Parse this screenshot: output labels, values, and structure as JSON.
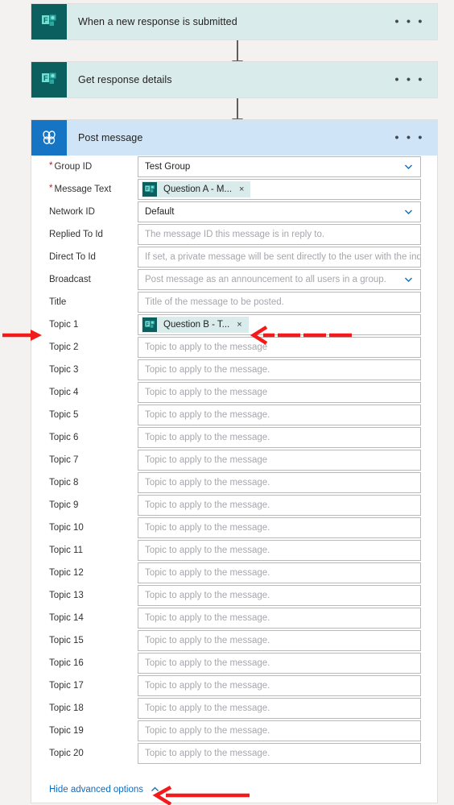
{
  "flow": {
    "steps": [
      {
        "id": "trigger",
        "title": "When a new response is submitted",
        "icon": "microsoft-forms-icon",
        "header_color": "#d9ebeb",
        "icon_bg": "#0c5f5f",
        "overflow_label": "• • •"
      },
      {
        "id": "get-response",
        "title": "Get response details",
        "icon": "microsoft-forms-icon",
        "header_color": "#d9ebeb",
        "icon_bg": "#0c5f5f",
        "overflow_label": "• • •"
      },
      {
        "id": "post-message",
        "title": "Post message",
        "icon": "yammer-icon",
        "header_color": "#cfe4f7",
        "icon_bg": "#1574c4",
        "overflow_label": "• • •"
      }
    ]
  },
  "post_message_form": {
    "fields": [
      {
        "label": "Group ID",
        "required": true,
        "type": "dropdown",
        "value": "Test Group",
        "placeholder": ""
      },
      {
        "label": "Message Text",
        "required": true,
        "type": "token",
        "token": "Question A - M...",
        "token_icon": "microsoft-forms-icon",
        "token_remove": "×",
        "placeholder": ""
      },
      {
        "label": "Network ID",
        "required": false,
        "type": "dropdown",
        "value": "Default",
        "placeholder": ""
      },
      {
        "label": "Replied To Id",
        "required": false,
        "type": "text",
        "value": "",
        "placeholder": "The message ID this message is in reply to."
      },
      {
        "label": "Direct To Id",
        "required": false,
        "type": "text",
        "value": "",
        "placeholder": "If set, a private message will be sent directly to the user with the indicated ID."
      },
      {
        "label": "Broadcast",
        "required": false,
        "type": "dropdown",
        "value": "",
        "placeholder": "Post message as an announcement to all users in a group."
      },
      {
        "label": "Title",
        "required": false,
        "type": "text",
        "value": "",
        "placeholder": "Title of the message to be posted."
      },
      {
        "label": "Topic 1",
        "required": false,
        "type": "token",
        "token": "Question B - T...",
        "token_icon": "microsoft-forms-icon",
        "token_remove": "×",
        "placeholder": ""
      },
      {
        "label": "Topic 2",
        "required": false,
        "type": "text",
        "value": "",
        "placeholder": "Topic to apply to the message"
      },
      {
        "label": "Topic 3",
        "required": false,
        "type": "text",
        "value": "",
        "placeholder": "Topic to apply to the message."
      },
      {
        "label": "Topic 4",
        "required": false,
        "type": "text",
        "value": "",
        "placeholder": "Topic to apply to the message"
      },
      {
        "label": "Topic 5",
        "required": false,
        "type": "text",
        "value": "",
        "placeholder": "Topic to apply to the message."
      },
      {
        "label": "Topic 6",
        "required": false,
        "type": "text",
        "value": "",
        "placeholder": "Topic to apply to the message."
      },
      {
        "label": "Topic 7",
        "required": false,
        "type": "text",
        "value": "",
        "placeholder": "Topic to apply to the message"
      },
      {
        "label": "Topic 8",
        "required": false,
        "type": "text",
        "value": "",
        "placeholder": "Topic to apply to the message."
      },
      {
        "label": "Topic 9",
        "required": false,
        "type": "text",
        "value": "",
        "placeholder": "Topic to apply to the message."
      },
      {
        "label": "Topic 10",
        "required": false,
        "type": "text",
        "value": "",
        "placeholder": "Topic to apply to the message."
      },
      {
        "label": "Topic 11",
        "required": false,
        "type": "text",
        "value": "",
        "placeholder": "Topic to apply to the message."
      },
      {
        "label": "Topic 12",
        "required": false,
        "type": "text",
        "value": "",
        "placeholder": "Topic to apply to the message."
      },
      {
        "label": "Topic 13",
        "required": false,
        "type": "text",
        "value": "",
        "placeholder": "Topic to apply to the message."
      },
      {
        "label": "Topic 14",
        "required": false,
        "type": "text",
        "value": "",
        "placeholder": "Topic to apply to the message."
      },
      {
        "label": "Topic 15",
        "required": false,
        "type": "text",
        "value": "",
        "placeholder": "Topic to apply to the message."
      },
      {
        "label": "Topic 16",
        "required": false,
        "type": "text",
        "value": "",
        "placeholder": "Topic to apply to the message."
      },
      {
        "label": "Topic 17",
        "required": false,
        "type": "text",
        "value": "",
        "placeholder": "Topic to apply to the message."
      },
      {
        "label": "Topic 18",
        "required": false,
        "type": "text",
        "value": "",
        "placeholder": "Topic to apply to the message."
      },
      {
        "label": "Topic 19",
        "required": false,
        "type": "text",
        "value": "",
        "placeholder": "Topic to apply to the message."
      },
      {
        "label": "Topic 20",
        "required": false,
        "type": "text",
        "value": "",
        "placeholder": "Topic to apply to the message."
      }
    ],
    "advanced_toggle": {
      "label": "Hide advanced options",
      "icon": "chevron-up-icon"
    }
  },
  "annotations": [
    {
      "name": "arrow-topic1-label",
      "direction": "right",
      "color": "#f21a1a"
    },
    {
      "name": "arrow-topic1-field",
      "direction": "left",
      "color": "#f21a1a"
    },
    {
      "name": "arrow-advanced-toggle",
      "direction": "left",
      "color": "#f21a1a"
    }
  ],
  "colors": {
    "canvas": "#f3f2f1",
    "forms_teal": "#0c5f5f",
    "yammer_blue": "#1574c4",
    "link_blue": "#0f6cbd",
    "required_red": "#a4262c",
    "annotation_red": "#f21a1a"
  }
}
